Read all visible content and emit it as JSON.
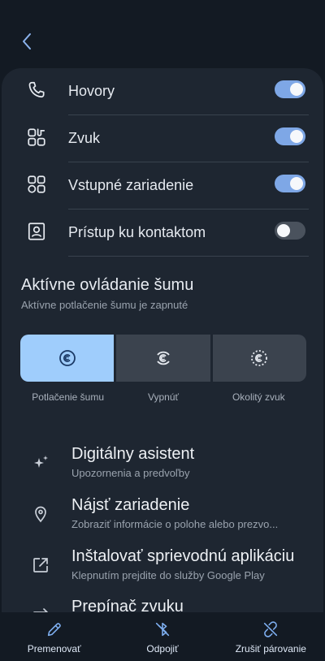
{
  "header": {
    "back_icon": "chevron-left-icon"
  },
  "toggles": [
    {
      "label": "Hovory",
      "icon": "phone-icon",
      "on": true
    },
    {
      "label": "Zvuk",
      "icon": "audio-apps-icon",
      "on": true
    },
    {
      "label": "Vstupné zariadenie",
      "icon": "grid-apps-icon",
      "on": true
    },
    {
      "label": "Prístup ku kontaktom",
      "icon": "contact-card-icon",
      "on": false
    }
  ],
  "anc": {
    "title": "Aktívne ovládanie šumu",
    "subtitle": "Aktívne potlačenie šumu je zapnuté",
    "options": [
      {
        "label": "Potlačenie šumu",
        "active": true
      },
      {
        "label": "Vypnúť",
        "active": false
      },
      {
        "label": "Okolitý zvuk",
        "active": false
      }
    ]
  },
  "items": [
    {
      "title": "Digitálny asistent",
      "subtitle": "Upozornenia a predvoľby",
      "icon": "sparkle-icon"
    },
    {
      "title": "Nájsť zariadenie",
      "subtitle": "Zobraziť informácie o polohe alebo prezvo...",
      "icon": "location-pin-icon"
    },
    {
      "title": "Inštalovať sprievodnú aplikáciu",
      "subtitle": "Klepnutím prejdite do služby Google Play",
      "icon": "open-external-icon"
    },
    {
      "title": "Prepínač zvuku",
      "subtitle": "",
      "icon": "switch-icon"
    }
  ],
  "bottom": [
    {
      "label": "Premenovať",
      "icon": "pencil-icon"
    },
    {
      "label": "Odpojiť",
      "icon": "bluetooth-off-icon"
    },
    {
      "label": "Zrušiť párovanie",
      "icon": "unlink-icon"
    }
  ],
  "colors": {
    "accent": "#7ea7e6",
    "active_segment": "#9fcdfc",
    "card": "#1e2631",
    "background": "#131a23"
  }
}
